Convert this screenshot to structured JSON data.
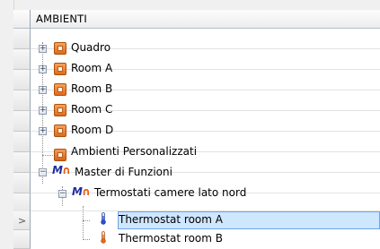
{
  "header": {
    "column_title": "AMBIENTI"
  },
  "tree": [
    {
      "label": "Quadro"
    },
    {
      "label": "Room A"
    },
    {
      "label": "Room B"
    },
    {
      "label": "Room C"
    },
    {
      "label": "Room D"
    },
    {
      "label": "Ambienti Personalizzati"
    },
    {
      "label": "Master di Funzioni"
    },
    {
      "label": "Termostati camere lato nord"
    },
    {
      "label": "Thermostat room A",
      "selected": true
    },
    {
      "label": "Thermostat room B"
    }
  ],
  "current_row_marker": ">",
  "expander_collapsed": "+",
  "expander_expanded": "−"
}
